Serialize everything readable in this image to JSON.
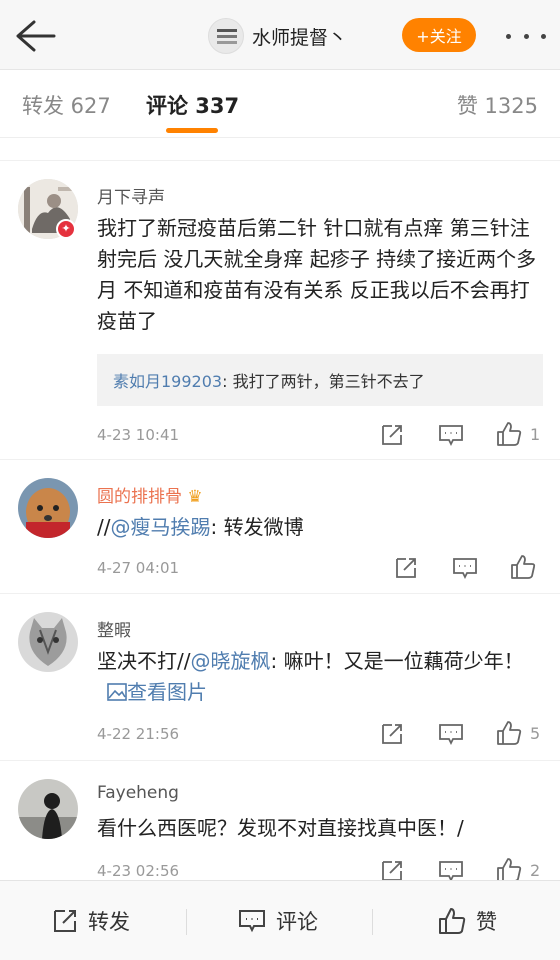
{
  "header": {
    "title": "水师提督丶",
    "follow_label": "+关注"
  },
  "tabs": {
    "forward": "转发 627",
    "comment": "评论 337",
    "like": "赞 1325"
  },
  "comments": [
    {
      "user": "月下寻声",
      "text": "我打了新冠疫苗后第二针 针口就有点痒 第三针注射完后 没几天就全身痒 起疹子 持续了接近两个多月 不知道和疫苗有没有关系 反正我以后不会再打疫苗了",
      "reply_user": "素如月199203",
      "reply_text": ": 我打了两针，第三针不去了",
      "time": "4-23 10:41",
      "likes": "1"
    },
    {
      "user": "圆的排排骨",
      "text_prefix": "//",
      "mention": "@瘦马挨踢",
      "text_suffix": ": 转发微博",
      "time": "4-27 04:01",
      "likes": ""
    },
    {
      "user": "整暇",
      "text_prefix": "坚决不打//",
      "mention": "@晓旋枫",
      "text_suffix": ": 嘛叶！又是一位藕荷少年！",
      "view_image": "查看图片",
      "time": "4-22 21:56",
      "likes": "5"
    },
    {
      "user": "Fayeheng",
      "text": "看什么西医呢？发现不对直接找真中医！/",
      "time": "4-23 02:56",
      "likes": "2"
    }
  ],
  "bottom": {
    "forward": "转发",
    "comment": "评论",
    "like": "赞"
  },
  "colors": {
    "accent": "#ff8200",
    "link": "#507daf",
    "username_vip": "#eb7350"
  }
}
